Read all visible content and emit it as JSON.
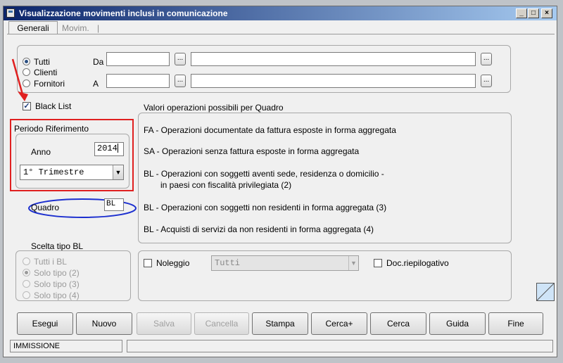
{
  "window": {
    "title": "Visualizzazione movimenti inclusi in comunicazione",
    "min": "_",
    "max": "□",
    "close": "×"
  },
  "tabs": [
    {
      "label": "Generali"
    },
    {
      "label": "Movim."
    }
  ],
  "tab_separator": "|",
  "filters": {
    "radio_tutti": "Tutti",
    "radio_clienti": "Clienti",
    "radio_fornitori": "Fornitori",
    "label_da": "Da",
    "label_a": "A",
    "ellipsis": "..."
  },
  "black_list": {
    "label": "Black List",
    "checked": true
  },
  "periodo": {
    "title": "Periodo Riferimento",
    "anno_label": "Anno",
    "anno_value": "2014",
    "trimestre_value": "1° Trimestre"
  },
  "quadro": {
    "label": "Quadro",
    "value": "BL"
  },
  "valori": {
    "title": "Valori operazioni possibili per Quadro",
    "lines": [
      "FA - Operazioni documentate da fattura esposte in forma aggregata",
      "SA - Operazioni senza fattura esposte in forma aggregata",
      "BL - Operazioni con soggetti aventi sede, residenza o domicilio -",
      "in paesi con fiscalità privilegiata (2)",
      "BL - Operazioni con soggetti non residenti in forma aggregata (3)",
      "BL - Acquisti di servizi da non residenti in forma aggregata (4)"
    ]
  },
  "scelta": {
    "title": "Scelta tipo BL",
    "options": [
      "Tutti i BL",
      "Solo tipo (2)",
      "Solo tipo (3)",
      "Solo tipo (4)"
    ]
  },
  "noleggio": {
    "label": "Noleggio",
    "select_value": "Tutti",
    "doc_label": "Doc.riepilogativo"
  },
  "buttons": {
    "esegui": "Esegui",
    "nuovo": "Nuovo",
    "salva": "Salva",
    "cancella": "Cancella",
    "stampa": "Stampa",
    "cerca_plus": "Cerca+",
    "cerca": "Cerca",
    "guida": "Guida",
    "fine": "Fine"
  },
  "status": {
    "mode": "IMMISSIONE",
    "message": ""
  },
  "colors": {
    "title_start": "#0a246a",
    "title_end": "#a6caf0",
    "highlight_red": "#e02020",
    "highlight_blue": "#1c2fcf"
  }
}
